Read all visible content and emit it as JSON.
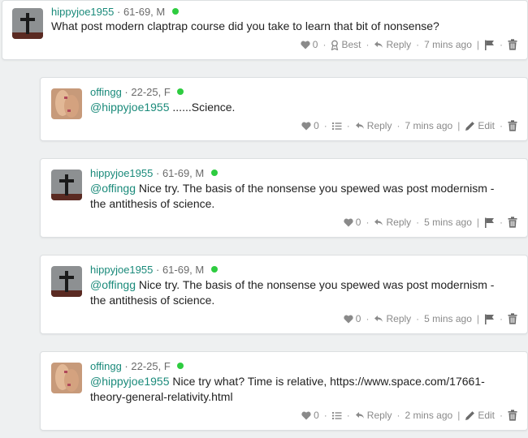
{
  "comments": [
    {
      "username": "hippyjoe1955",
      "age_sex": "61-69, M",
      "mention": "",
      "text": "What post modern claptrap course did you take to learn that bit of nonsense?",
      "likes": "0",
      "best_label": "Best",
      "reply_label": "Reply",
      "time": "7 mins ago",
      "avatar": "cross-avatar",
      "actions": [
        "like",
        "best",
        "reply",
        "time",
        "flag",
        "delete"
      ]
    },
    {
      "username": "offingg",
      "age_sex": "22-25, F",
      "mention": "@hippyjoe1955",
      "text": " ......Science.",
      "likes": "0",
      "reply_label": "Reply",
      "time": "7 mins ago",
      "edit_label": "Edit",
      "avatar": "hands-avatar",
      "actions": [
        "like",
        "list",
        "reply",
        "time",
        "edit",
        "delete"
      ]
    },
    {
      "username": "hippyjoe1955",
      "age_sex": "61-69, M",
      "mention": "@offingg",
      "text": " Nice try. The basis of the nonsense you spewed was post modernism - the antithesis of science.",
      "likes": "0",
      "reply_label": "Reply",
      "time": "5 mins ago",
      "avatar": "cross-avatar",
      "actions": [
        "like",
        "reply",
        "time",
        "flag",
        "delete"
      ]
    },
    {
      "username": "hippyjoe1955",
      "age_sex": "61-69, M",
      "mention": "@offingg",
      "text": " Nice try. The basis of the nonsense you spewed was post modernism - the antithesis of science.",
      "likes": "0",
      "reply_label": "Reply",
      "time": "5 mins ago",
      "avatar": "cross-avatar",
      "actions": [
        "like",
        "reply",
        "time",
        "flag",
        "delete"
      ]
    },
    {
      "username": "offingg",
      "age_sex": "22-25, F",
      "mention": "@hippyjoe1955",
      "text": " Nice try what? Time is relative, https://www.space.com/17661-theory-general-relativity.html",
      "likes": "0",
      "reply_label": "Reply",
      "time": "2 mins ago",
      "edit_label": "Edit",
      "avatar": "hands-avatar",
      "actions": [
        "like",
        "list",
        "reply",
        "time",
        "edit",
        "delete"
      ]
    }
  ],
  "colors": {
    "username": "#1a8a7a",
    "online": "#2ecc40",
    "muted": "#8a8a8a",
    "background": "#eef0f1"
  }
}
